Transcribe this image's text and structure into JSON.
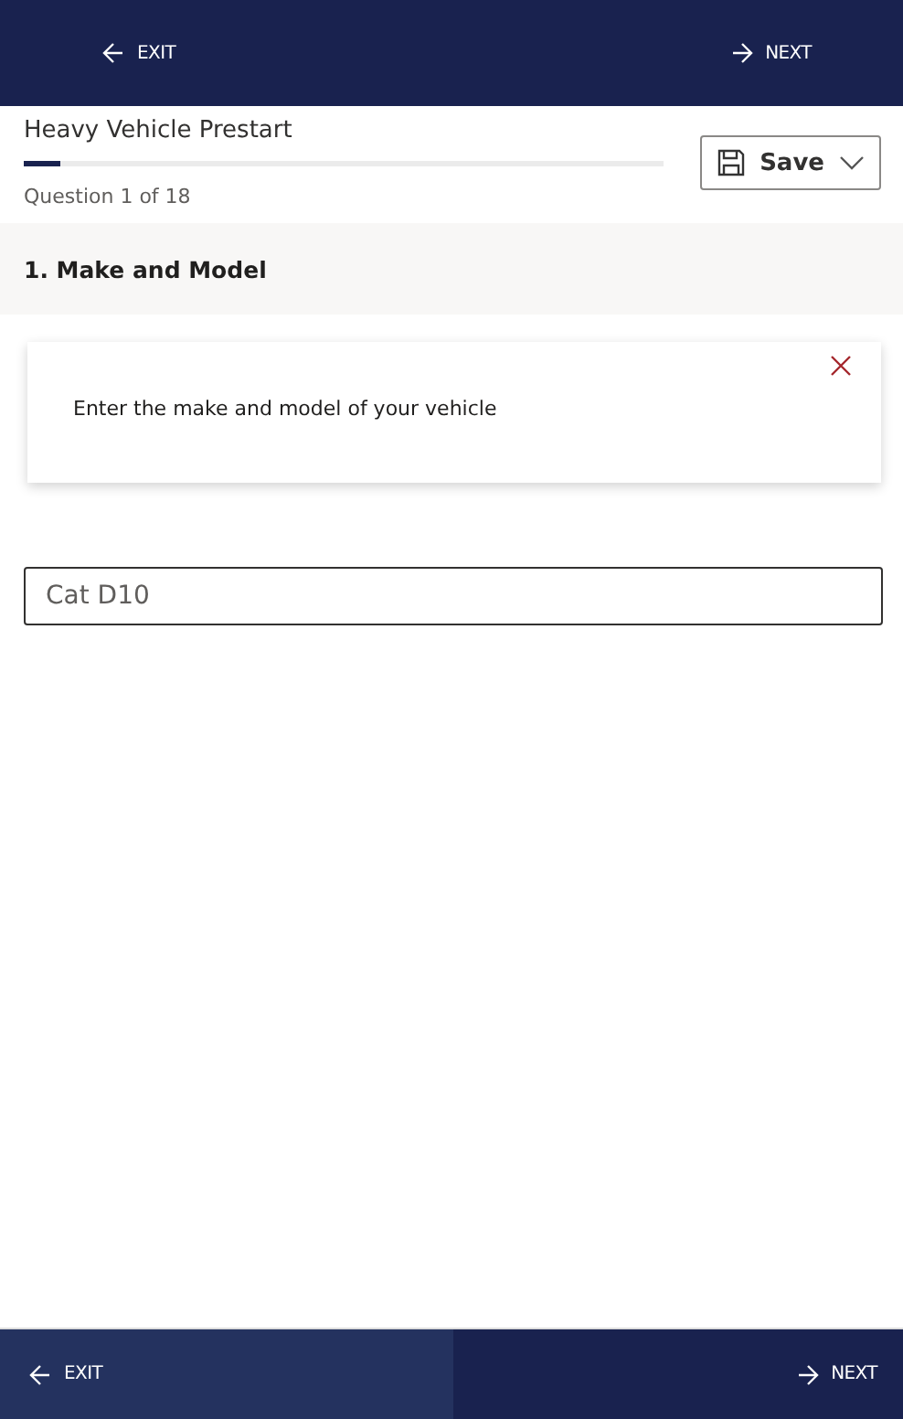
{
  "header": {
    "exit": "EXIT",
    "next": "NEXT"
  },
  "form": {
    "title": "Heavy Vehicle Prestart",
    "progress": {
      "level": 0.056
    },
    "counter": "Question 1 of 18",
    "save": "Save"
  },
  "question": {
    "heading": "1. Make and Model",
    "hint": "Enter the make and model of your vehicle",
    "answer": "Cat D10"
  },
  "footer": [
    {
      "kind": "exit",
      "label": "EXIT",
      "hovered": true
    },
    {
      "kind": "next",
      "label": "NEXT",
      "hovered": false
    }
  ]
}
